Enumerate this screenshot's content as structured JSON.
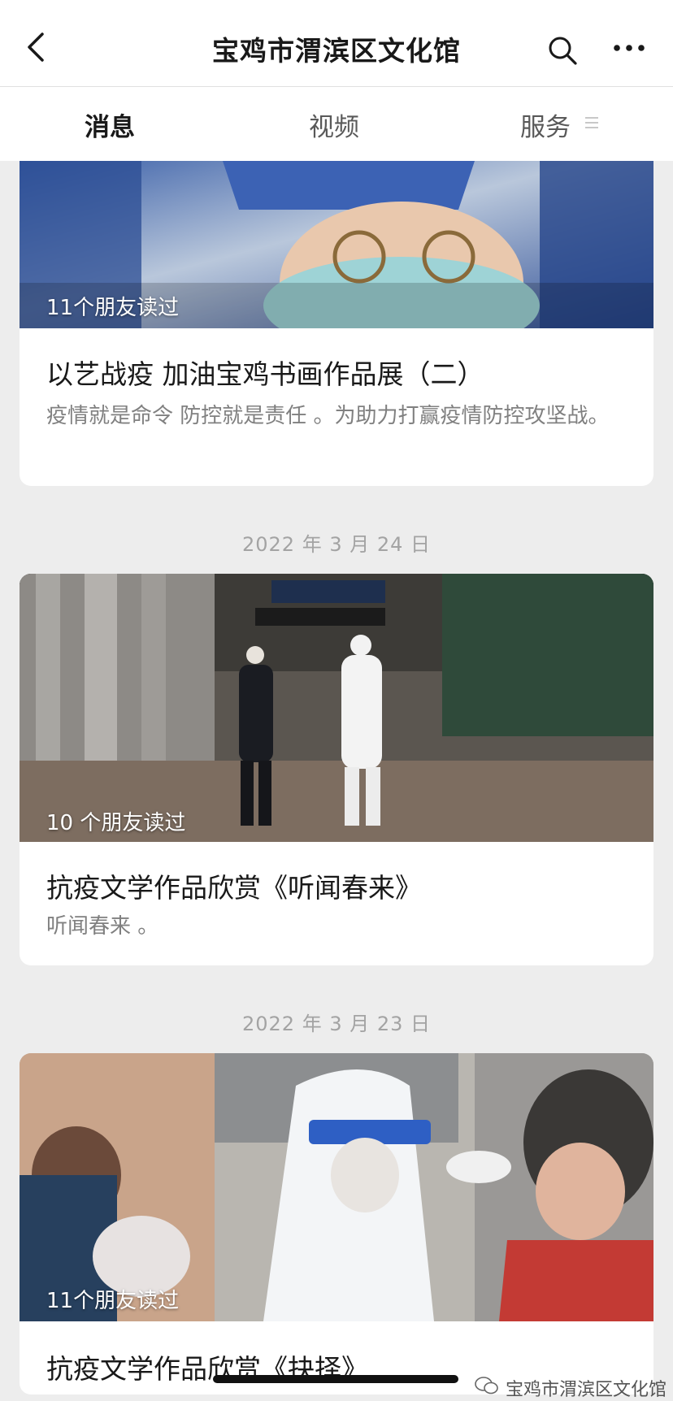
{
  "header": {
    "title": "宝鸡市渭滨区文化馆",
    "back_icon": "chevron-left-icon",
    "search_icon": "search-icon",
    "more_icon": "more-icon"
  },
  "tabs": [
    {
      "label": "消息",
      "active": true
    },
    {
      "label": "视频",
      "active": false
    },
    {
      "label": "服务",
      "active": false
    }
  ],
  "articles": [
    {
      "read_count": "11个朋友读过",
      "title": "以艺战疫 加油宝鸡书画作品展（二）",
      "description": "疫情就是命令 防控就是责任 。为助力打赢疫情防控攻坚战。"
    },
    {
      "date": "2022 年 3 月 24 日",
      "read_count": "10 个朋友读过",
      "title": "抗疫文学作品欣赏《听闻春来》",
      "description": "听闻春来 。"
    },
    {
      "date": "2022 年 3 月 23 日",
      "read_count": "11个朋友读过",
      "title": "抗疫文学作品欣赏《抉择》"
    }
  ],
  "watermark": "宝鸡市渭滨区文化馆",
  "colors": {
    "background": "#ededed",
    "card": "#ffffff",
    "text_primary": "#191919",
    "text_secondary": "#808080",
    "date_text": "#a3a3a3"
  }
}
